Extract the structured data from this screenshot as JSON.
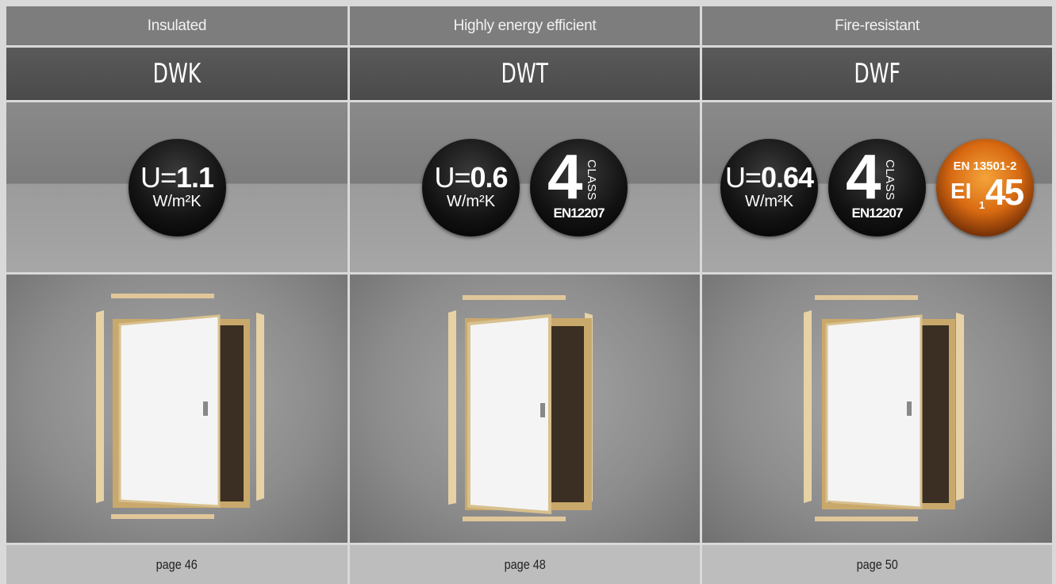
{
  "columns": [
    {
      "feature": "Insulated",
      "model": "DWK",
      "u_prefix": "U=",
      "u_value": "1.1",
      "u_unit": "W/m²K",
      "page": "page 46"
    },
    {
      "feature": "Highly energy efficient",
      "model": "DWT",
      "u_prefix": "U=",
      "u_value": "0.6",
      "u_unit": "W/m²K",
      "class_number": "4",
      "class_word": "CLASS",
      "class_standard": "EN12207",
      "page": "page 48"
    },
    {
      "feature": "Fire-resistant",
      "model": "DWF",
      "u_prefix": "U=",
      "u_value": "0.64",
      "u_unit": "W/m²K",
      "class_number": "4",
      "class_word": "CLASS",
      "class_standard": "EN12207",
      "fire_standard": "EN 13501-2",
      "fire_ei": "EI",
      "fire_sub": "1",
      "fire_value": "45",
      "page": "page 50"
    }
  ],
  "colors": {
    "feature_bg": "#7d7d7d",
    "model_bg": "#4f4f4f",
    "page_bg": "#bdbdbd",
    "frame": "#d9d9d9"
  }
}
